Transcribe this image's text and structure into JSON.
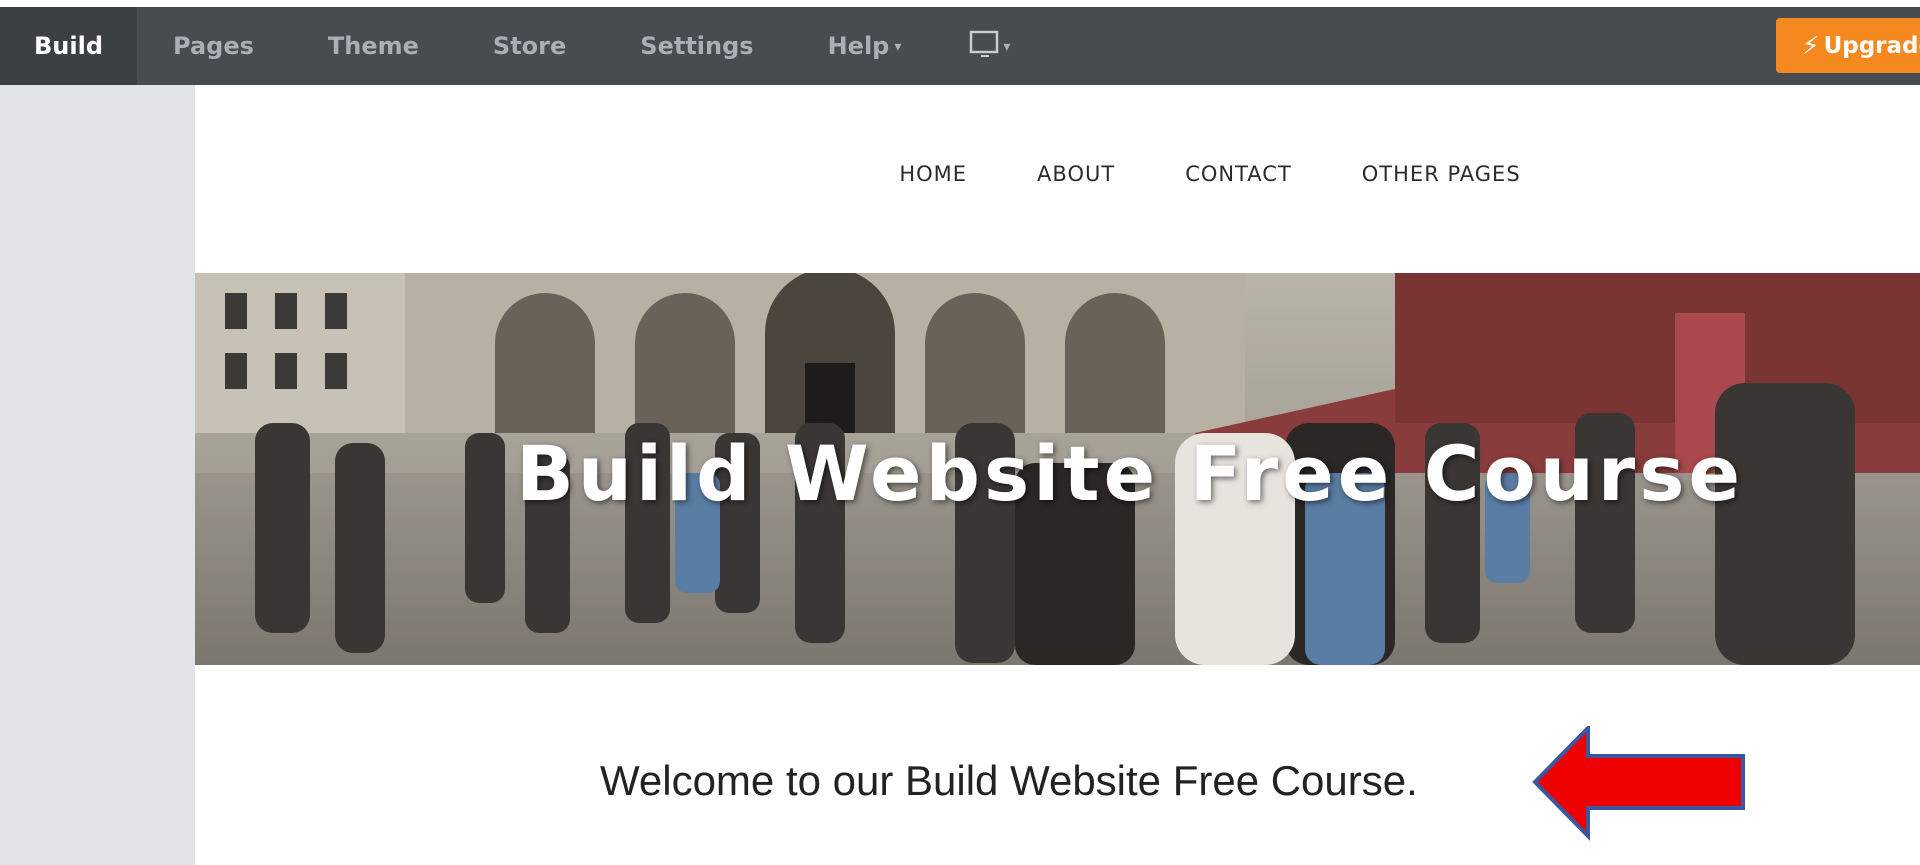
{
  "toolbar": {
    "tabs": [
      {
        "label": "Build"
      },
      {
        "label": "Pages"
      },
      {
        "label": "Theme"
      },
      {
        "label": "Store"
      },
      {
        "label": "Settings"
      },
      {
        "label": "Help"
      }
    ],
    "device_icon": "desktop-monitor-icon",
    "upgrade_label": "Upgrade",
    "upgrade_icon": "lightning-bolt-icon",
    "colors": {
      "bar": "#474c51",
      "active_tab": "#3b4045",
      "upgrade": "#f5891f"
    }
  },
  "site": {
    "nav": [
      {
        "label": "HOME"
      },
      {
        "label": "ABOUT"
      },
      {
        "label": "CONTACT"
      },
      {
        "label": "OTHER PAGES"
      }
    ],
    "banner_title": "Build Website Free Course",
    "welcome_text": "Welcome to our Build Website Free Course.",
    "annotation": {
      "icon": "red-arrow-left-icon",
      "color": "#ee0000"
    }
  }
}
